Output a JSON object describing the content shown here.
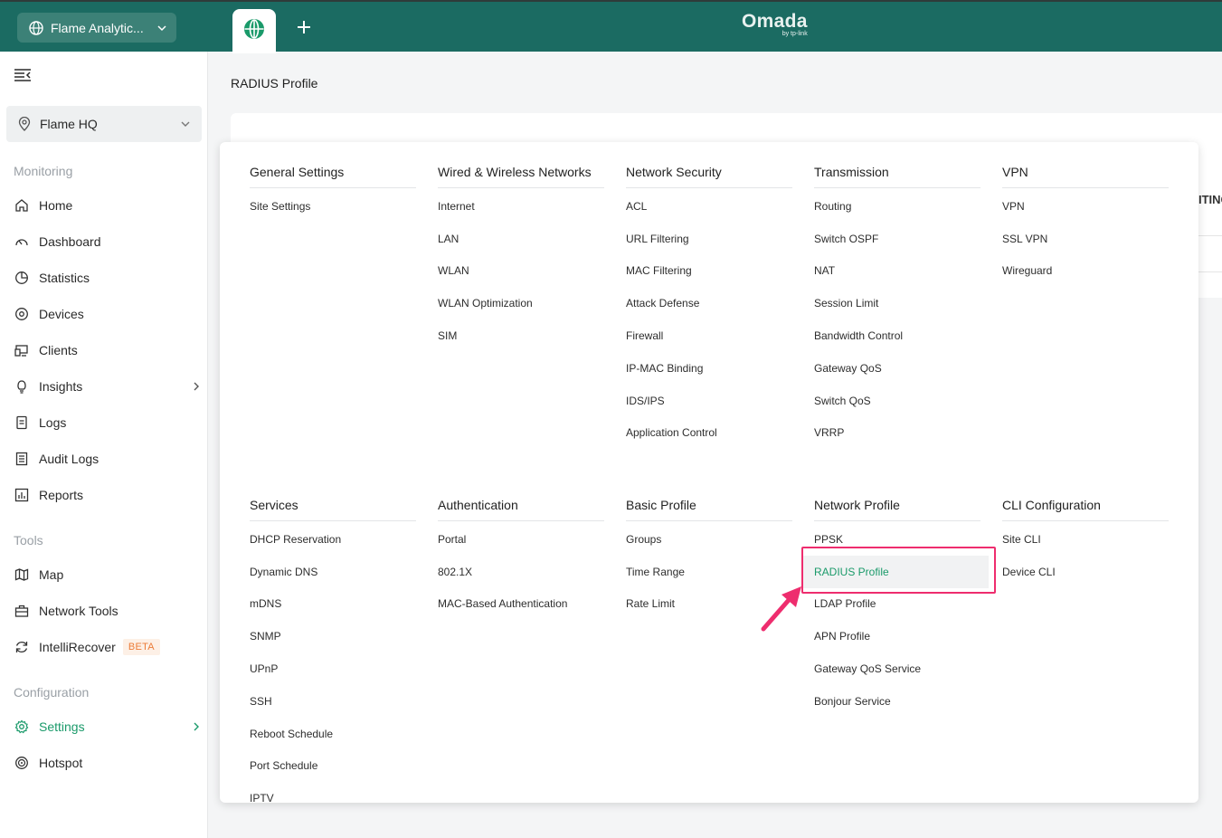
{
  "topbar": {
    "org_name": "Flame Analytic...",
    "brand": "Omada",
    "brand_sub": "by tp-link"
  },
  "page": {
    "title": "RADIUS Profile",
    "bg_clip_text": "ITING"
  },
  "sidebar": {
    "site": "Flame HQ",
    "sections": {
      "monitoring": "Monitoring",
      "tools": "Tools",
      "configuration": "Configuration"
    },
    "items": {
      "home": "Home",
      "dashboard": "Dashboard",
      "statistics": "Statistics",
      "devices": "Devices",
      "clients": "Clients",
      "insights": "Insights",
      "logs": "Logs",
      "audit_logs": "Audit Logs",
      "reports": "Reports",
      "map": "Map",
      "network_tools": "Network Tools",
      "intellirecover": "IntelliRecover",
      "beta": "BETA",
      "settings": "Settings",
      "hotspot": "Hotspot"
    }
  },
  "menu": {
    "general": {
      "title": "General Settings",
      "items": [
        "Site Settings"
      ]
    },
    "wired": {
      "title": "Wired & Wireless Networks",
      "items": [
        "Internet",
        "LAN",
        "WLAN",
        "WLAN Optimization",
        "SIM"
      ]
    },
    "security": {
      "title": "Network Security",
      "items": [
        "ACL",
        "URL Filtering",
        "MAC Filtering",
        "Attack Defense",
        "Firewall",
        "IP-MAC Binding",
        "IDS/IPS",
        "Application Control"
      ]
    },
    "transmission": {
      "title": "Transmission",
      "items": [
        "Routing",
        "Switch OSPF",
        "NAT",
        "Session Limit",
        "Bandwidth Control",
        "Gateway QoS",
        "Switch QoS",
        "VRRP"
      ]
    },
    "vpn": {
      "title": "VPN",
      "items": [
        "VPN",
        "SSL VPN",
        "Wireguard"
      ]
    },
    "services": {
      "title": "Services",
      "items": [
        "DHCP Reservation",
        "Dynamic DNS",
        "mDNS",
        "SNMP",
        "UPnP",
        "SSH",
        "Reboot Schedule",
        "Port Schedule",
        "IPTV"
      ]
    },
    "auth": {
      "title": "Authentication",
      "items": [
        "Portal",
        "802.1X",
        "MAC-Based Authentication"
      ]
    },
    "basic": {
      "title": "Basic Profile",
      "items": [
        "Groups",
        "Time Range",
        "Rate Limit"
      ]
    },
    "netprofile": {
      "title": "Network Profile",
      "items": [
        "PPSK",
        "RADIUS Profile",
        "LDAP Profile",
        "APN Profile",
        "Gateway QoS Service",
        "Bonjour Service"
      ]
    },
    "cli": {
      "title": "CLI Configuration",
      "items": [
        "Site CLI",
        "Device CLI"
      ]
    }
  },
  "colors": {
    "topbar": "#1b6b62",
    "accent": "#1a9a6a",
    "annotation": "#ee2d6e"
  }
}
